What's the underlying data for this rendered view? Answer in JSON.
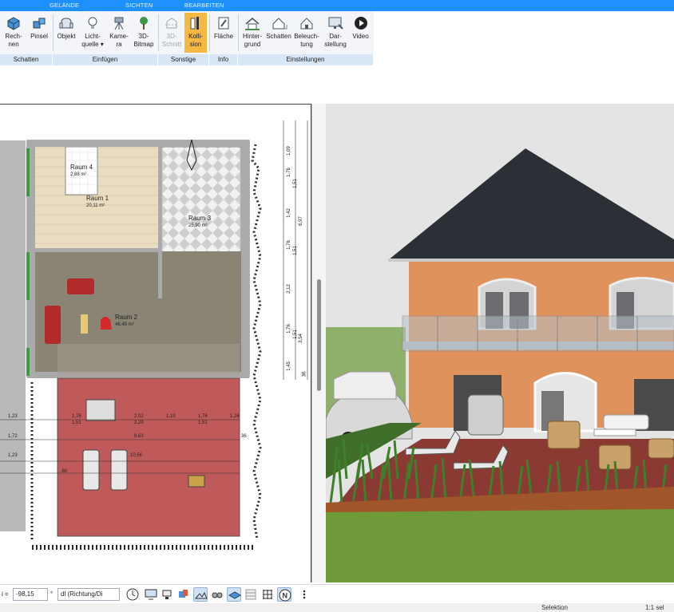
{
  "tabs": [
    "GELÄNDE",
    "SICHTEN",
    "BEARBEITEN"
  ],
  "ribbon": {
    "buttons": [
      {
        "line1": "Rech-",
        "line2": "nen"
      },
      {
        "line1": "Pinsel",
        "line2": ""
      },
      {
        "line1": "Objekt",
        "line2": ""
      },
      {
        "line1": "Licht-",
        "line2": "quelle ▾"
      },
      {
        "line1": "Kame-",
        "line2": "ra"
      },
      {
        "line1": "3D-",
        "line2": "Bitmap"
      },
      {
        "line1": "3D-",
        "line2": "Schnitt"
      },
      {
        "line1": "Kolli-",
        "line2": "sion"
      },
      {
        "line1": "Fläche",
        "line2": ""
      },
      {
        "line1": "Hinter-",
        "line2": "grund"
      },
      {
        "line1": "Schatten",
        "line2": ""
      },
      {
        "line1": "Beleuch-",
        "line2": "tung"
      },
      {
        "line1": "Dar-",
        "line2": "stellung"
      },
      {
        "line1": "Video",
        "line2": ""
      }
    ],
    "groups": [
      "Schatten",
      "Einfügen",
      "Sonstige",
      "Info",
      "Einstellungen"
    ]
  },
  "plan": {
    "rooms": [
      {
        "name": "Raum 4",
        "area": "2,88 m²"
      },
      {
        "name": "Raum 1",
        "area": "20,11 m²"
      },
      {
        "name": "Raum 3",
        "area": "25,90 m²"
      },
      {
        "name": "Raum 2",
        "area": "46,45 m²"
      }
    ],
    "right_dims": [
      "1,09",
      "1,76",
      "1,51",
      "1,42",
      "6,97",
      "1,76",
      "1,51",
      "2,12",
      "1,76",
      "1,51",
      "3,54",
      "1,45",
      "36"
    ],
    "terrace_dims": [
      "1,23",
      "1,76",
      "1,51",
      "2,02",
      "2,20",
      "1,10",
      "1,76",
      "1,51",
      "1,26",
      "1,72",
      "9,63",
      "1,23",
      "10,56",
      ",60",
      "36"
    ]
  },
  "bottombar": {
    "angle_label": "i =",
    "angle_value": "-98,15",
    "degree": "°",
    "direction_value": "dl (Richtung/Di"
  },
  "status": {
    "mode": "Selektion",
    "scale": "1:1 sel"
  },
  "colors": {
    "ribbon_blue": "#1e90ff",
    "active_button": "#f5b942",
    "roof": "#2b2f36",
    "wall": "#e0925c",
    "terrace": "#8b3a33"
  }
}
